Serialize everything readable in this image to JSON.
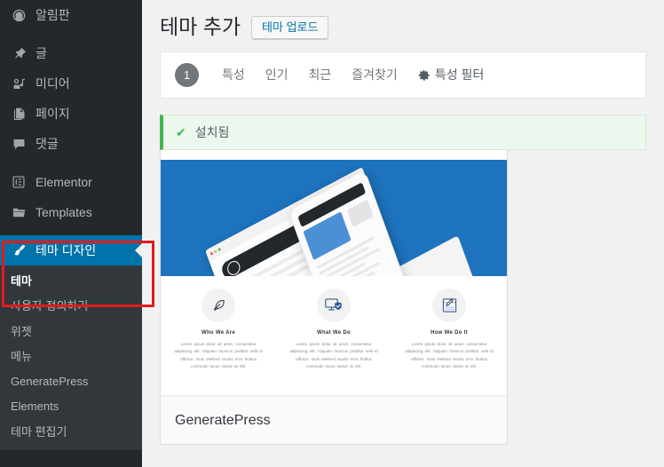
{
  "sidebar": {
    "items": [
      {
        "label": "알림판",
        "icon": "dashboard-icon",
        "name": "sidebar-item-dashboard"
      },
      {
        "label": "글",
        "icon": "pin-icon",
        "name": "sidebar-item-posts"
      },
      {
        "label": "미디어",
        "icon": "media-icon",
        "name": "sidebar-item-media"
      },
      {
        "label": "페이지",
        "icon": "page-icon",
        "name": "sidebar-item-pages"
      },
      {
        "label": "댓글",
        "icon": "comment-icon",
        "name": "sidebar-item-comments"
      },
      {
        "label": "Elementor",
        "icon": "elementor-icon",
        "name": "sidebar-item-elementor"
      },
      {
        "label": "Templates",
        "icon": "folder-icon",
        "name": "sidebar-item-templates"
      }
    ],
    "appearance": {
      "label": "테마 디자인",
      "icon": "paintbrush-icon",
      "active_color": "#0073aa"
    },
    "submenu": [
      {
        "label": "테마",
        "current": true
      },
      {
        "label": "사용자 정의하기",
        "current": false
      },
      {
        "label": "위젯",
        "current": false
      },
      {
        "label": "메뉴",
        "current": false
      },
      {
        "label": "GeneratePress",
        "current": false
      },
      {
        "label": "Elements",
        "current": false
      },
      {
        "label": "테마 편집기",
        "current": false
      }
    ],
    "background_color": "#23282d",
    "submenu_background_color": "#32373c"
  },
  "annotation": {
    "color": "#e01b1b",
    "shape": "rectangle"
  },
  "header": {
    "title": "테마 추가",
    "upload_button": "테마 업로드"
  },
  "filter_bar": {
    "count_badge": "1",
    "tabs": [
      {
        "label": "특성",
        "name": "tab-featured"
      },
      {
        "label": "인기",
        "name": "tab-popular"
      },
      {
        "label": "최근",
        "name": "tab-latest"
      },
      {
        "label": "즐겨찾기",
        "name": "tab-favorites"
      }
    ],
    "feature_filter": {
      "label": "특성 필터",
      "icon": "gear-icon"
    }
  },
  "notice": {
    "icon": "check-icon",
    "text": "설치됨",
    "accent_color": "#46b450",
    "background_color": "#ecf7ed"
  },
  "theme_card": {
    "name": "GeneratePress",
    "screenshot": {
      "hero_color": "#1e73be",
      "columns": [
        {
          "title": "Who We Are",
          "icon": "feather-icon",
          "body": "Lorem ipsum dolor sit amet, consectetur adipiscing elit. Aliquam rhoncus porttitor velit id efficitur. Duis eleifend iaculis eros finibus commodo lacus varius at elit."
        },
        {
          "title": "What We Do",
          "icon": "monitor-shield-icon",
          "body": "Lorem ipsum dolor sit amet, consectetur adipiscing elit. Aliquam rhoncus porttitor velit id efficitur. Duis eleifend iaculis eros finibus commodo lacus varius at elit."
        },
        {
          "title": "How We Do It",
          "icon": "document-edit-icon",
          "body": "Lorem ipsum dolor sit amet, consectetur adipiscing elit. Aliquam rhoncus porttitor velit id efficitur. Duis eleifend iaculis eros finibus commodo lacus varius at elit."
        }
      ]
    }
  }
}
